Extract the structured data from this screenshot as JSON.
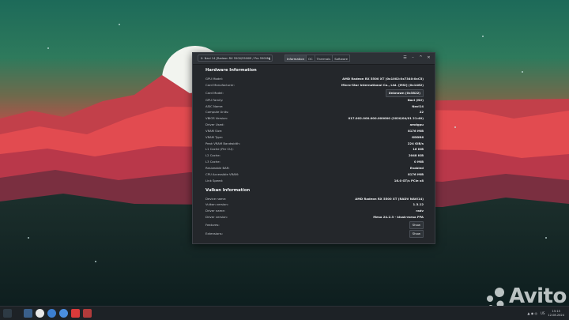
{
  "window": {
    "gpu_select": "0: Navi 14 [Radeon RX 5500/5500M / Pro 5500M]",
    "tabs": [
      "Information",
      "OC",
      "Thermals",
      "Software"
    ],
    "active_tab": "Information",
    "controls": [
      "☰",
      "–",
      "^",
      "✕"
    ]
  },
  "hardware": {
    "title": "Hardware Information",
    "rows": [
      {
        "label": "GPU Model:",
        "value": "AMD Radeon RX 5500 XT (0x1002:0x7340:0xC5)"
      },
      {
        "label": "Card Manufacturer:",
        "value": "Micro-Star International Co., Ltd. [MSI] (0x1462)"
      },
      {
        "label": "Card Model:",
        "value": "Unknown (0x3822)"
      },
      {
        "label": "GPU Family:",
        "value": "Navi (NV)"
      },
      {
        "label": "ASIC Name:",
        "value": "Navi14"
      },
      {
        "label": "Compute Units:",
        "value": "22"
      },
      {
        "label": "VBIOS Version:",
        "value": "017.002.000.000.000000 (2020/04/01 21:40)"
      },
      {
        "label": "Driver Used:",
        "value": "amdgpu"
      },
      {
        "label": "VRAM Size:",
        "value": "8176 MiB"
      },
      {
        "label": "VRAM Type:",
        "value": "GDDR6"
      },
      {
        "label": "Peak VRAM Bandwidth:",
        "value": "224 GiB/s"
      },
      {
        "label": "L1 Cache (Per CU):",
        "value": "16 KiB"
      },
      {
        "label": "L2 Cache:",
        "value": "2048 KiB"
      },
      {
        "label": "L3 Cache:",
        "value": "0 MiB"
      },
      {
        "label": "Resizeable BAR:",
        "value": "Enabled"
      },
      {
        "label": "CPU Accessible VRAM:",
        "value": "8176 MiB"
      },
      {
        "label": "Link Speed:",
        "value": "16.0 GT/s PCIe x8"
      }
    ]
  },
  "vulkan": {
    "title": "Vulkan Information",
    "rows": [
      {
        "label": "Device name:",
        "value": "AMD Radeon RX 5500 XT (RADV NAVI14)"
      },
      {
        "label": "Vulkan version:",
        "value": "1.3.12"
      },
      {
        "label": "Driver name:",
        "value": "radv"
      },
      {
        "label": "Driver version:",
        "value": "Mesa 24.2.3 - kisak-mesa PPA"
      }
    ],
    "features_label": "Features:",
    "extensions_label": "Extensions:",
    "show_label": "Show"
  },
  "taskbar": {
    "lang": "US",
    "time": "15:15",
    "date": "12.08.2024"
  },
  "watermark": "Avito",
  "colors": {
    "sky_top": "#1f6f5f",
    "sky_mid": "#b34545",
    "mountain_front": "#e0484f",
    "panel_bg": "#24272b"
  }
}
